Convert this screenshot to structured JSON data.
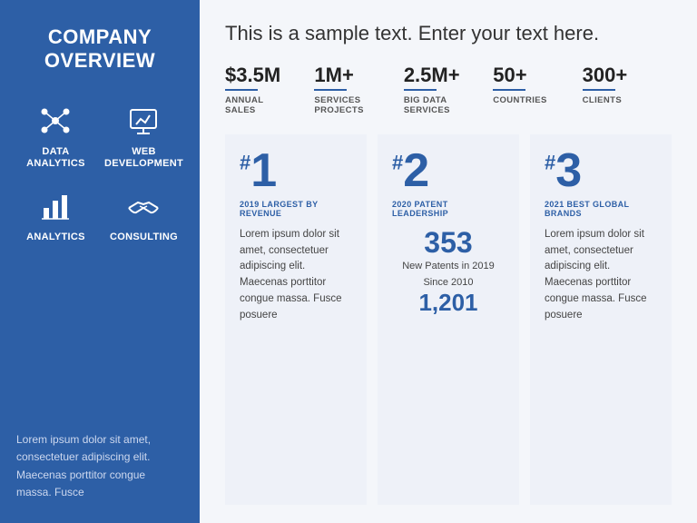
{
  "sidebar": {
    "title": "COMPANY\nOVERVIEW",
    "icons": [
      {
        "id": "data-analytics",
        "label": "DATA\nANALYTICS",
        "icon": "network"
      },
      {
        "id": "web-development",
        "label": "WEB\nDEVELOPMENT",
        "icon": "presentation"
      },
      {
        "id": "analytics",
        "label": "ANALYTICS",
        "icon": "barchart"
      },
      {
        "id": "consulting",
        "label": "CONSULTING",
        "icon": "handshake"
      }
    ],
    "description": "Lorem ipsum dolor sit amet, consectetuer adipiscing elit. Maecenas porttitor congue massa. Fusce"
  },
  "main": {
    "tagline": "This is a sample text. Enter your text here.",
    "stats": [
      {
        "value": "$3.5M",
        "label": "ANNUAL\nSALES"
      },
      {
        "value": "1M+",
        "label": "SERVICES\nPROJECTS"
      },
      {
        "value": "2.5M+",
        "label": "BIG DATA\nSERVICES"
      },
      {
        "value": "50+",
        "label": "COUNTRIES"
      },
      {
        "value": "300+",
        "label": "CLIENTS"
      }
    ],
    "rankings": [
      {
        "number": "1",
        "title": "2019 LARGEST BY REVENUE",
        "type": "text",
        "body": "Lorem ipsum dolor sit amet, consectetuer adipiscing elit. Maecenas porttitor congue massa. Fusce posuere"
      },
      {
        "number": "2",
        "title": "2020 PATENT LEADERSHIP",
        "type": "numbers",
        "big_num": "353",
        "big_label": "New Patents in 2019",
        "since_label": "Since 2010",
        "since_num": "1,201"
      },
      {
        "number": "3",
        "title": "2021 BEST GLOBAL BRANDS",
        "type": "text",
        "body": "Lorem ipsum dolor sit amet, consectetuer adipiscing elit. Maecenas porttitor congue massa. Fusce posuere"
      }
    ]
  }
}
